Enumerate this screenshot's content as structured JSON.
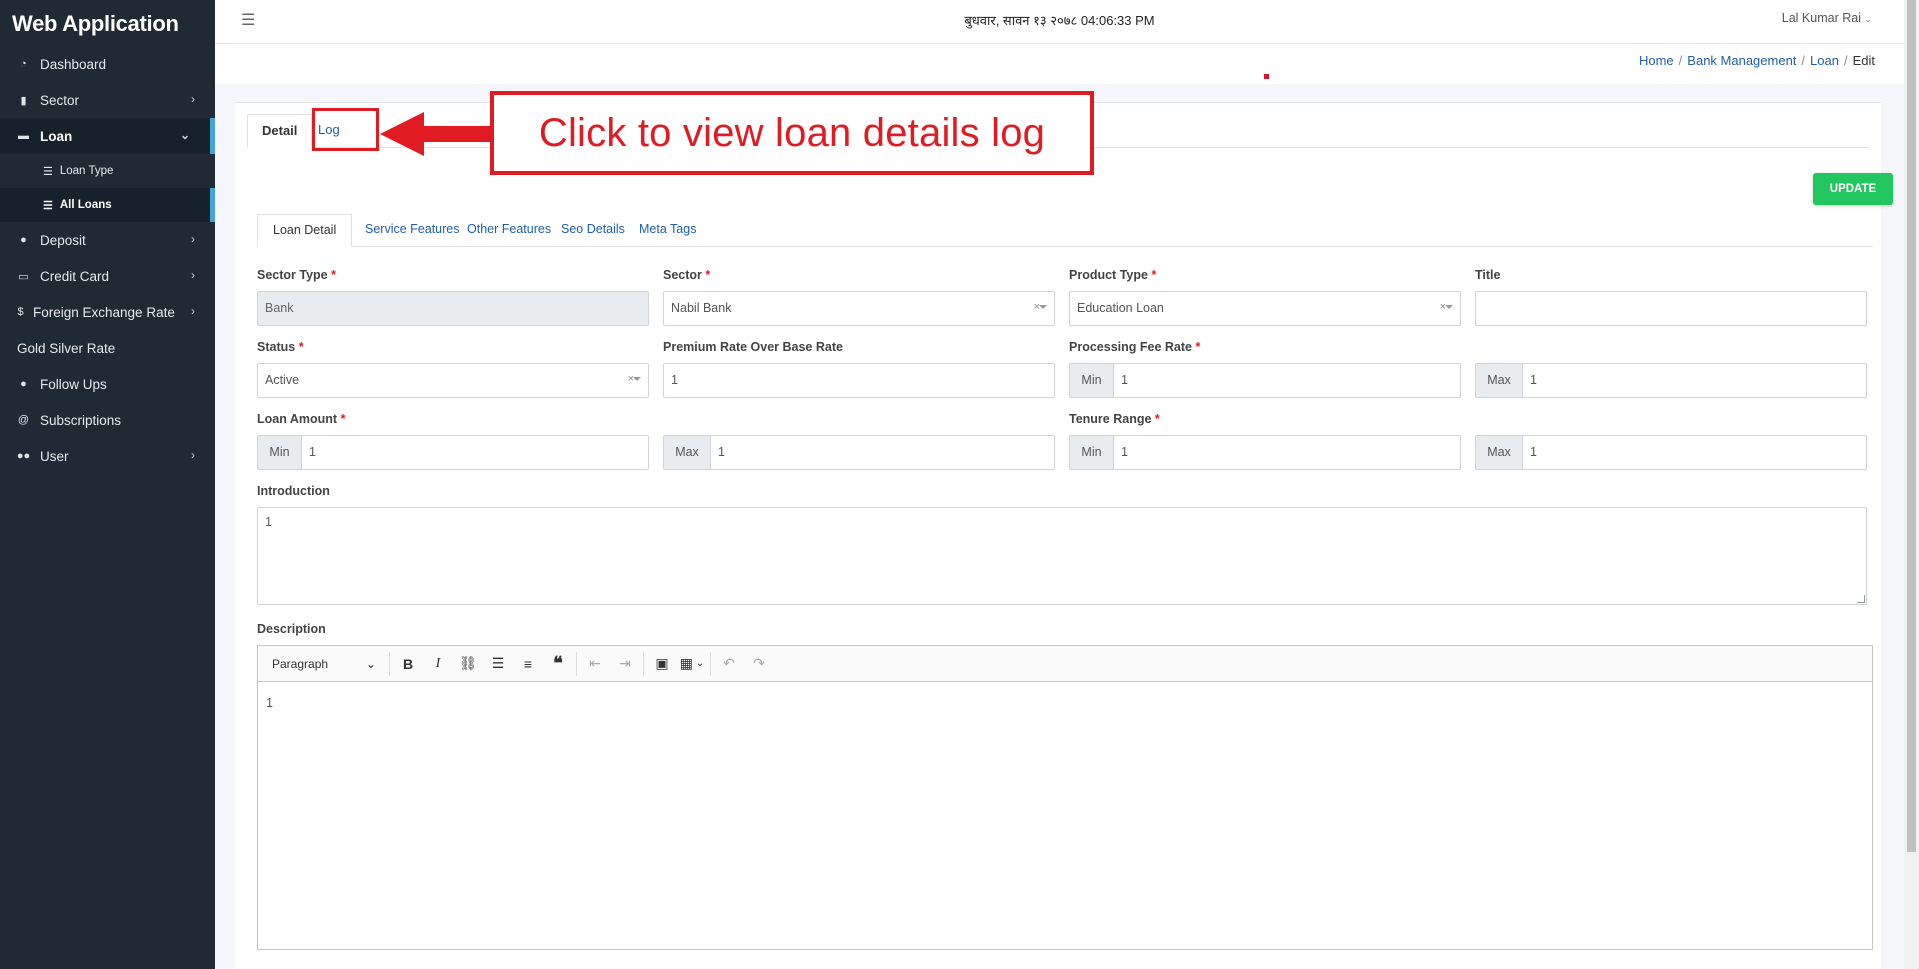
{
  "app": {
    "title": "Web Application"
  },
  "sidebar": {
    "items": [
      {
        "label": "Dashboard",
        "icon": "dashboard-icon",
        "chevron": false
      },
      {
        "label": "Sector",
        "icon": "sector-icon",
        "chevron": true
      },
      {
        "label": "Loan",
        "icon": "loan-card-icon",
        "chevron": true,
        "open": true
      },
      {
        "label": "Loan Type",
        "icon": "list-icon",
        "sub": true
      },
      {
        "label": "All Loans",
        "icon": "list-icon",
        "sub": true,
        "active": true
      },
      {
        "label": "Deposit",
        "icon": "piggy-bank-icon",
        "chevron": true
      },
      {
        "label": "Credit Card",
        "icon": "credit-card-icon",
        "chevron": true
      },
      {
        "label": "Foreign Exchange Rate",
        "icon": "dollar-icon",
        "chevron": true
      },
      {
        "label": "Gold Silver Rate",
        "icon": "",
        "chevron": false
      },
      {
        "label": "Follow Ups",
        "icon": "user-plus-icon",
        "chevron": false
      },
      {
        "label": "Subscriptions",
        "icon": "at-icon",
        "chevron": false
      },
      {
        "label": "User",
        "icon": "users-icon",
        "chevron": true
      }
    ]
  },
  "topbar": {
    "datetime": "बुधवार, सावन १३ २०७८ 04:06:33 PM",
    "user": "Lal Kumar Rai"
  },
  "breadcrumb": {
    "home": "Home",
    "bank": "Bank Management",
    "loan": "Loan",
    "current": "Edit"
  },
  "tabs": {
    "detail": "Detail",
    "log": "Log"
  },
  "annotation": {
    "text": "Click to view loan details log"
  },
  "update_label": "UPDATE",
  "inner_tabs": {
    "loan_detail": "Loan Detail",
    "service": "Service Features",
    "other": "Other Features",
    "seo": "Seo Details",
    "meta": "Meta Tags"
  },
  "form": {
    "sector_type": {
      "label": "Sector Type",
      "value": "Bank"
    },
    "sector": {
      "label": "Sector",
      "value": "Nabil Bank"
    },
    "product_type": {
      "label": "Product Type",
      "value": "Education Loan"
    },
    "title": {
      "label": "Title",
      "value": ""
    },
    "status": {
      "label": "Status",
      "value": "Active"
    },
    "premium": {
      "label": "Premium Rate Over Base Rate",
      "value": "1"
    },
    "processing": {
      "label": "Processing Fee Rate",
      "min": "1",
      "max": "1"
    },
    "loan_amount": {
      "label": "Loan Amount",
      "min": "1",
      "max": "1"
    },
    "tenure": {
      "label": "Tenure Range",
      "min": "1",
      "max": "1"
    },
    "introduction": {
      "label": "Introduction",
      "value": "1"
    },
    "description": {
      "label": "Description",
      "value": "1",
      "format": "Paragraph"
    },
    "min": "Min",
    "max": "Max",
    "req": "*",
    "clear": "×"
  }
}
